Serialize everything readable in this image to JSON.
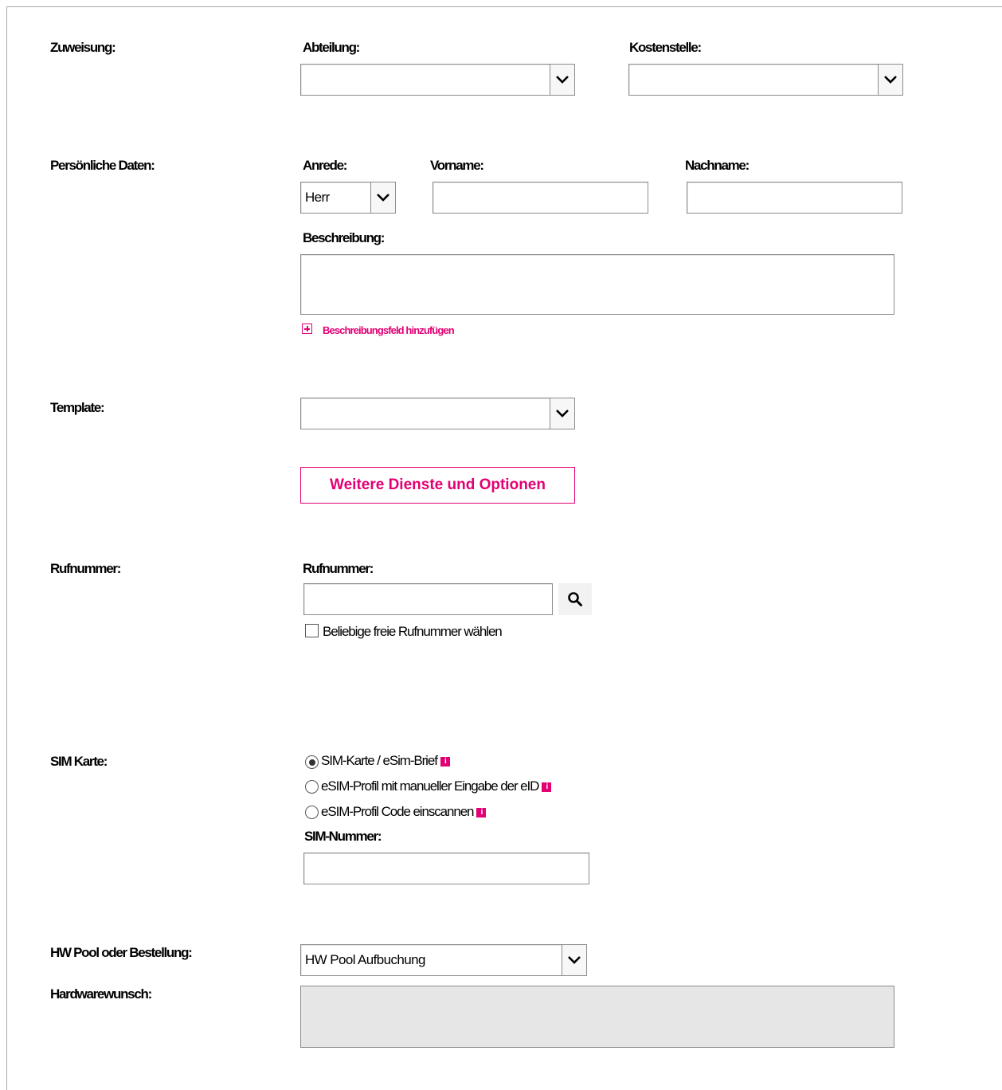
{
  "colors": {
    "accent": "#e20074",
    "border": "#8c8c8c",
    "disabled_bg": "#e6e6e6"
  },
  "assignment": {
    "section_label": "Zuweisung:",
    "department_label": "Abteilung:",
    "department_value": "",
    "cost_center_label": "Kostenstelle:",
    "cost_center_value": ""
  },
  "personal": {
    "section_label": "Persönliche Daten:",
    "salutation_label": "Anrede:",
    "salutation_value": "Herr",
    "first_name_label": "Vorname:",
    "first_name_value": "",
    "last_name_label": "Nachname:",
    "last_name_value": "",
    "description_label": "Beschreibung:",
    "description_value": "",
    "add_description_link": "Beschreibungsfeld hinzufügen",
    "add_icon": "plus-box-icon"
  },
  "template": {
    "section_label": "Template:",
    "value": "",
    "more_services_button": "Weitere Dienste und Optionen"
  },
  "phone": {
    "section_label": "Rufnummer:",
    "field_label": "Rufnummer:",
    "value": "",
    "search_icon": "search-icon",
    "any_free_number_label": "Beliebige freie Rufnummer wählen",
    "any_free_number_checked": false
  },
  "sim": {
    "section_label": "SIM Karte:",
    "options": [
      {
        "label": "SIM-Karte / eSim-Brief",
        "checked": true
      },
      {
        "label": "eSIM-Profil mit manueller Eingabe der eID",
        "checked": false
      },
      {
        "label": "eSIM-Profil Code einscannen",
        "checked": false
      }
    ],
    "info_icon_glyph": "i",
    "sim_number_label": "SIM-Nummer:",
    "sim_number_value": ""
  },
  "hardware": {
    "pool_section_label": "HW Pool oder Bestellung:",
    "pool_value": "HW Pool Aufbuchung",
    "wish_label": "Hardwarewunsch:",
    "wish_value": ""
  }
}
